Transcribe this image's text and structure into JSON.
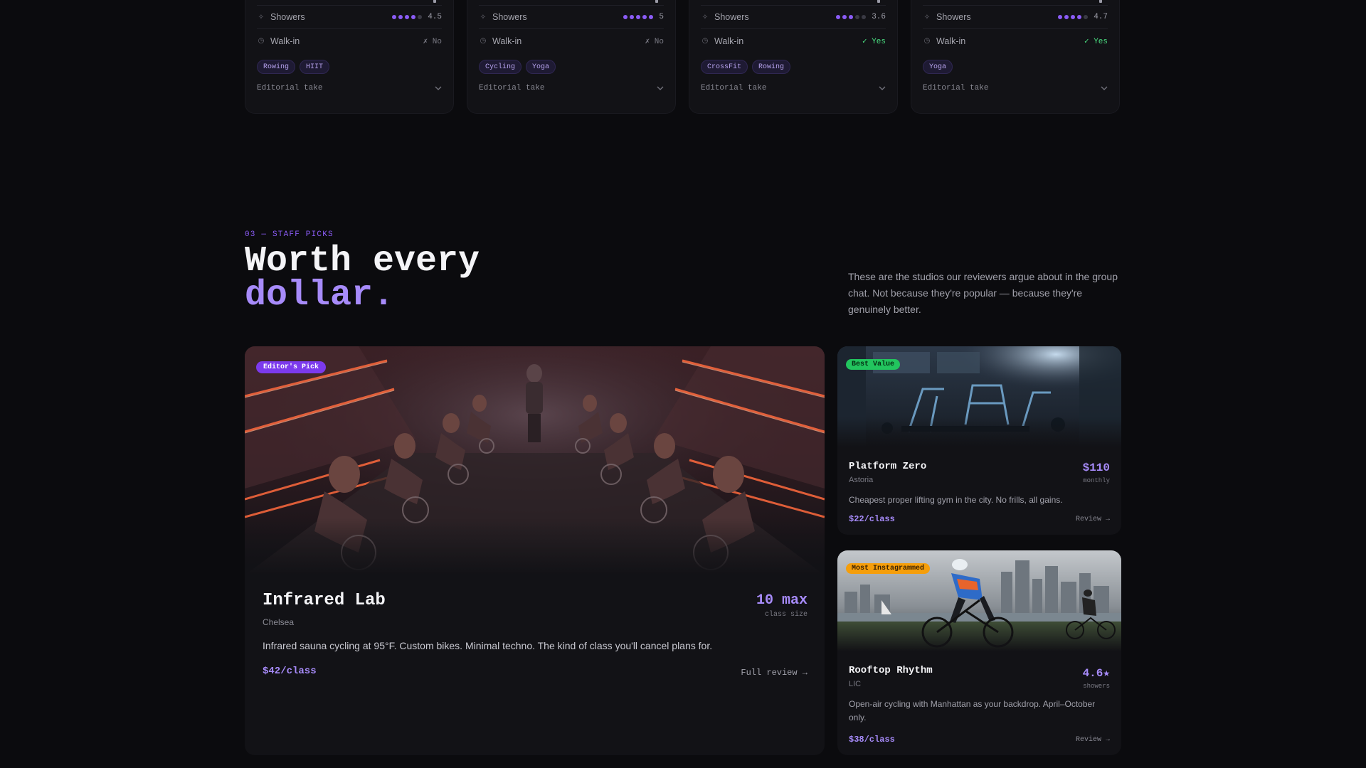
{
  "compare": {
    "cards": [
      {
        "showers_label": "Showers",
        "showers_score": "4.5",
        "showers_level": 4,
        "walkin_label": "Walk-in",
        "walkin_value": "✗ No",
        "walkin_yes": false,
        "tags": [
          "Rowing",
          "HIIT"
        ],
        "editorial_label": "Editorial take"
      },
      {
        "showers_label": "Showers",
        "showers_score": "5",
        "showers_level": 5,
        "walkin_label": "Walk-in",
        "walkin_value": "✗ No",
        "walkin_yes": false,
        "tags": [
          "Cycling",
          "Yoga"
        ],
        "editorial_label": "Editorial take"
      },
      {
        "showers_label": "Showers",
        "showers_score": "3.6",
        "showers_level": 3,
        "walkin_label": "Walk-in",
        "walkin_value": "✓ Yes",
        "walkin_yes": true,
        "tags": [
          "CrossFit",
          "Rowing"
        ],
        "editorial_label": "Editorial take"
      },
      {
        "showers_label": "Showers",
        "showers_score": "4.7",
        "showers_level": 4,
        "walkin_label": "Walk-in",
        "walkin_value": "✓ Yes",
        "walkin_yes": true,
        "tags": [
          "Yoga"
        ],
        "editorial_label": "Editorial take"
      }
    ]
  },
  "section": {
    "kicker": "03 — STAFF PICKS",
    "headline_line1": "Worth every",
    "headline_line2": "dollar.",
    "intro": "These are the studios our reviewers argue about in the group chat. Not because they're popular — because they're genuinely better."
  },
  "featured": {
    "badge": "Editor's Pick",
    "title": "Infrared Lab",
    "location": "Chelsea",
    "description": "Infrared sauna cycling at 95°F. Custom bikes. Minimal techno. The kind of class you'll cancel plans for.",
    "price": "$42/class",
    "stat_value": "10 max",
    "stat_label": "class size",
    "link": "Full review →"
  },
  "side_cards": [
    {
      "badge": "Best Value",
      "title": "Platform Zero",
      "location": "Astoria",
      "description": "Cheapest proper lifting gym in the city. No frills, all gains.",
      "price": "$22/class",
      "stat_value": "$110",
      "stat_label": "monthly",
      "link": "Review →"
    },
    {
      "badge": "Most Instagrammed",
      "title": "Rooftop Rhythm",
      "location": "LIC",
      "description": "Open-air cycling with Manhattan as your backdrop. April–October only.",
      "price": "$38/class",
      "stat_value": "4.6★",
      "stat_label": "showers",
      "link": "Review →"
    }
  ],
  "colors": {
    "background": "#0b0b0e",
    "card": "#121216",
    "accent": "#a78bfa",
    "badge_purple": "#7c3aed",
    "badge_green": "#22c55e",
    "badge_orange": "#f59e0b",
    "yes_green": "#4ade80"
  }
}
